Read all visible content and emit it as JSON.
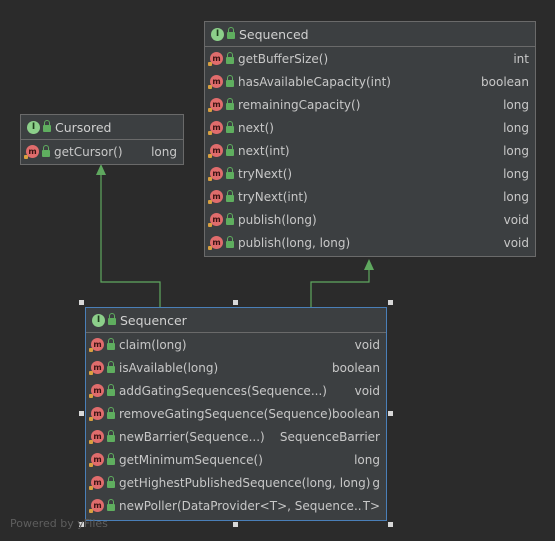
{
  "watermark": "Powered by yFiles",
  "colors": {
    "background": "#2b2b2b",
    "box": "#3c3f41",
    "arrow": "#5fa85f",
    "selection": "#4a7fb8"
  },
  "cursored": {
    "title": "Cursored",
    "icon": "interface-icon",
    "methods": [
      {
        "name": "getCursor()",
        "type": "long"
      }
    ]
  },
  "sequenced": {
    "title": "Sequenced",
    "icon": "interface-icon",
    "methods": [
      {
        "name": "getBufferSize()",
        "type": "int"
      },
      {
        "name": "hasAvailableCapacity(int)",
        "type": "boolean"
      },
      {
        "name": "remainingCapacity()",
        "type": "long"
      },
      {
        "name": "next()",
        "type": "long"
      },
      {
        "name": "next(int)",
        "type": "long"
      },
      {
        "name": "tryNext()",
        "type": "long"
      },
      {
        "name": "tryNext(int)",
        "type": "long"
      },
      {
        "name": "publish(long)",
        "type": "void"
      },
      {
        "name": "publish(long, long)",
        "type": "void"
      }
    ]
  },
  "sequencer": {
    "title": "Sequencer",
    "icon": "interface-icon",
    "methods": [
      {
        "name": "claim(long)",
        "type": "void"
      },
      {
        "name": "isAvailable(long)",
        "type": "boolean"
      },
      {
        "name": "addGatingSequences(Sequence...)",
        "type": "void"
      },
      {
        "name": "removeGatingSequence(Sequence)",
        "type": "boolean"
      },
      {
        "name": "newBarrier(Sequence...)",
        "type": "SequenceBarrier"
      },
      {
        "name": "getMinimumSequence()",
        "type": "long"
      },
      {
        "name": "getHighestPublishedSequence(long, long)",
        "type": "g"
      },
      {
        "name": "newPoller(DataProvider<T>, Sequence...)",
        "type": "T>"
      }
    ]
  }
}
